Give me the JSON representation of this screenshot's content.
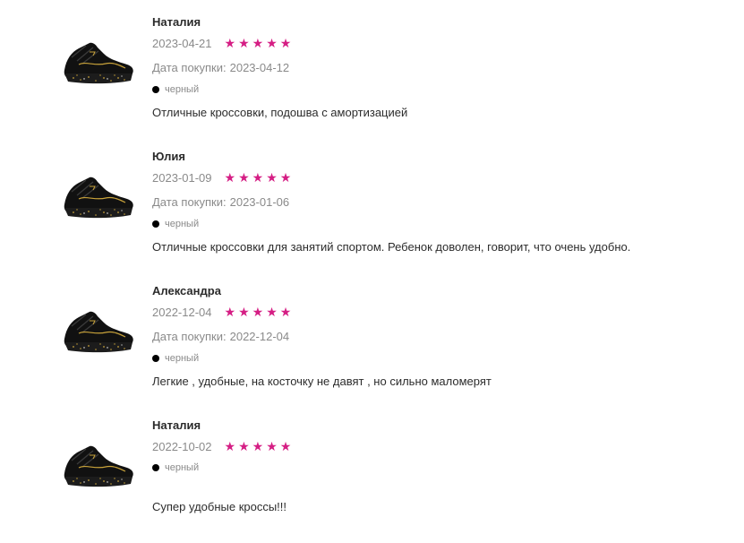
{
  "icons": {
    "product": "sneaker-thumbnail-icon",
    "star": "star-icon",
    "color_swatch": "color-dot-icon"
  },
  "colors": {
    "star": "#d51e84",
    "swatch": "#000000",
    "muted_text": "#8a8a8a"
  },
  "reviews": [
    {
      "author": "Наталия",
      "date": "2023-04-21",
      "rating": 5,
      "purchase_label": "Дата покупки:",
      "purchase_date": "2023-04-12",
      "color": "черный",
      "text": "Отличные кроссовки, подошва с амортизацией"
    },
    {
      "author": "Юлия",
      "date": "2023-01-09",
      "rating": 5,
      "purchase_label": "Дата покупки:",
      "purchase_date": "2023-01-06",
      "color": "черный",
      "text": "Отличные кроссовки для занятий спортом. Ребенок доволен, говорит, что очень удобно."
    },
    {
      "author": "Александра",
      "date": "2022-12-04",
      "rating": 5,
      "purchase_label": "Дата покупки:",
      "purchase_date": "2022-12-04",
      "color": "черный",
      "text": "Легкие , удобные, на косточку не давят , но сильно маломерят"
    },
    {
      "author": "Наталия",
      "date": "2022-10-02",
      "rating": 5,
      "color": "черный",
      "text": "Супер удобные кроссы!!!"
    }
  ]
}
